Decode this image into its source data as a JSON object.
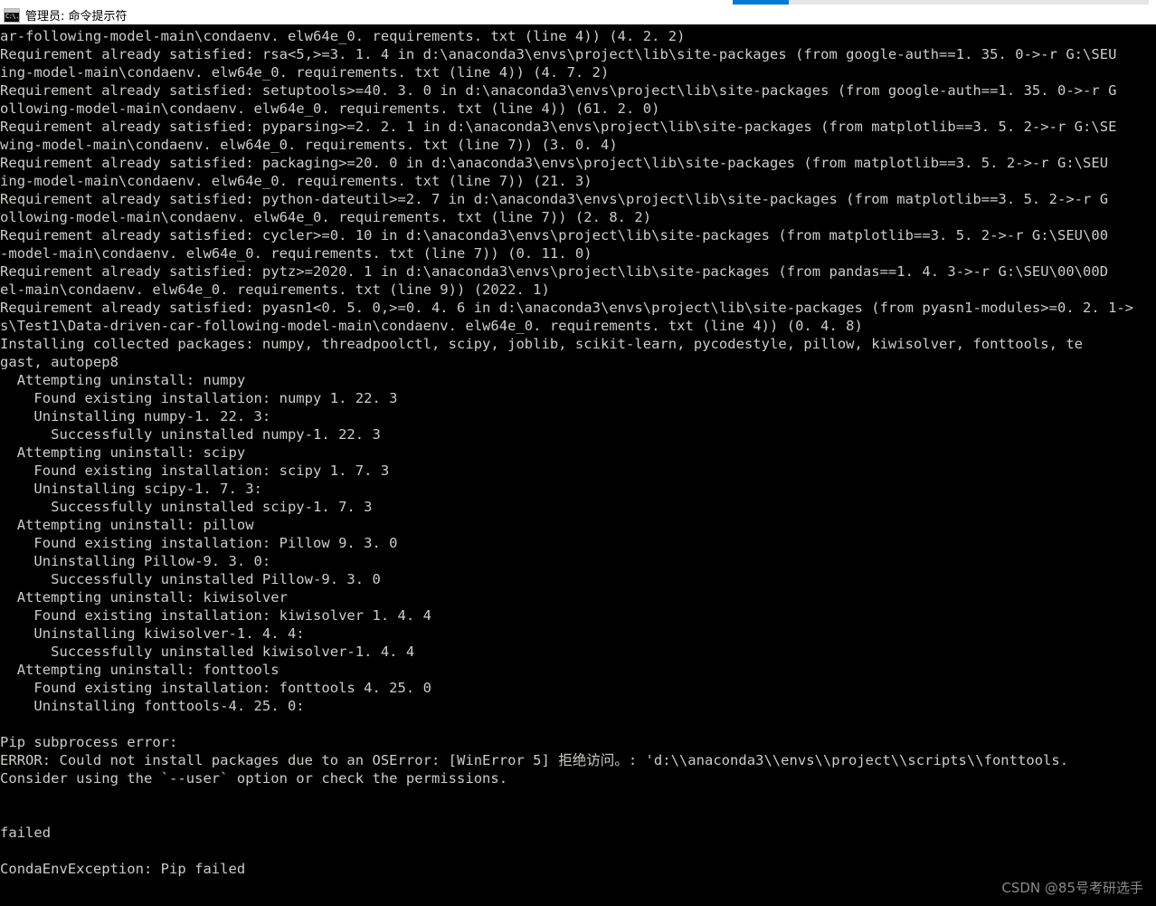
{
  "window": {
    "icon": "cmd-console-icon",
    "title": "管理员: 命令提示符"
  },
  "scrollbar": {
    "orientation": "horizontal",
    "thumb_color": "#0078d4",
    "track_color": "#e6e6e6"
  },
  "colors": {
    "terminal_background": "#000000",
    "terminal_foreground": "#ccccc8",
    "accent": "#0078d4",
    "titlebar_background": "#ffffff",
    "watermark": "#8a8a8a"
  },
  "terminal": {
    "lines": [
      "ar-following-model-main\\condaenv. elw64e_0. requirements. txt (line 4)) (4. 2. 2)",
      "Requirement already satisfied: rsa<5,>=3. 1. 4 in d:\\anaconda3\\envs\\project\\lib\\site-packages (from google-auth==1. 35. 0->-r G:\\SEU",
      "ing-model-main\\condaenv. elw64e_0. requirements. txt (line 4)) (4. 7. 2)",
      "Requirement already satisfied: setuptools>=40. 3. 0 in d:\\anaconda3\\envs\\project\\lib\\site-packages (from google-auth==1. 35. 0->-r G",
      "ollowing-model-main\\condaenv. elw64e_0. requirements. txt (line 4)) (61. 2. 0)",
      "Requirement already satisfied: pyparsing>=2. 2. 1 in d:\\anaconda3\\envs\\project\\lib\\site-packages (from matplotlib==3. 5. 2->-r G:\\SE",
      "wing-model-main\\condaenv. elw64e_0. requirements. txt (line 7)) (3. 0. 4)",
      "Requirement already satisfied: packaging>=20. 0 in d:\\anaconda3\\envs\\project\\lib\\site-packages (from matplotlib==3. 5. 2->-r G:\\SEU",
      "ing-model-main\\condaenv. elw64e_0. requirements. txt (line 7)) (21. 3)",
      "Requirement already satisfied: python-dateutil>=2. 7 in d:\\anaconda3\\envs\\project\\lib\\site-packages (from matplotlib==3. 5. 2->-r G",
      "ollowing-model-main\\condaenv. elw64e_0. requirements. txt (line 7)) (2. 8. 2)",
      "Requirement already satisfied: cycler>=0. 10 in d:\\anaconda3\\envs\\project\\lib\\site-packages (from matplotlib==3. 5. 2->-r G:\\SEU\\00",
      "-model-main\\condaenv. elw64e_0. requirements. txt (line 7)) (0. 11. 0)",
      "Requirement already satisfied: pytz>=2020. 1 in d:\\anaconda3\\envs\\project\\lib\\site-packages (from pandas==1. 4. 3->-r G:\\SEU\\00\\00D",
      "el-main\\condaenv. elw64e_0. requirements. txt (line 9)) (2022. 1)",
      "Requirement already satisfied: pyasn1<0. 5. 0,>=0. 4. 6 in d:\\anaconda3\\envs\\project\\lib\\site-packages (from pyasn1-modules>=0. 2. 1->",
      "s\\Test1\\Data-driven-car-following-model-main\\condaenv. elw64e_0. requirements. txt (line 4)) (0. 4. 8)",
      "Installing collected packages: numpy, threadpoolctl, scipy, joblib, scikit-learn, pycodestyle, pillow, kiwisolver, fonttools, te",
      "gast, autopep8",
      "  Attempting uninstall: numpy",
      "    Found existing installation: numpy 1. 22. 3",
      "    Uninstalling numpy-1. 22. 3:",
      "      Successfully uninstalled numpy-1. 22. 3",
      "  Attempting uninstall: scipy",
      "    Found existing installation: scipy 1. 7. 3",
      "    Uninstalling scipy-1. 7. 3:",
      "      Successfully uninstalled scipy-1. 7. 3",
      "  Attempting uninstall: pillow",
      "    Found existing installation: Pillow 9. 3. 0",
      "    Uninstalling Pillow-9. 3. 0:",
      "      Successfully uninstalled Pillow-9. 3. 0",
      "  Attempting uninstall: kiwisolver",
      "    Found existing installation: kiwisolver 1. 4. 4",
      "    Uninstalling kiwisolver-1. 4. 4:",
      "      Successfully uninstalled kiwisolver-1. 4. 4",
      "  Attempting uninstall: fonttools",
      "    Found existing installation: fonttools 4. 25. 0",
      "    Uninstalling fonttools-4. 25. 0:",
      "",
      "Pip subprocess error:",
      "ERROR: Could not install packages due to an OSError: [WinError 5] 拒绝访问。: 'd:\\\\anaconda3\\\\envs\\\\project\\\\scripts\\\\fonttools.",
      "Consider using the `--user` option or check the permissions.",
      "",
      "",
      "failed",
      "",
      "CondaEnvException: Pip failed"
    ]
  },
  "watermark": {
    "text": "CSDN @85号考研选手"
  }
}
